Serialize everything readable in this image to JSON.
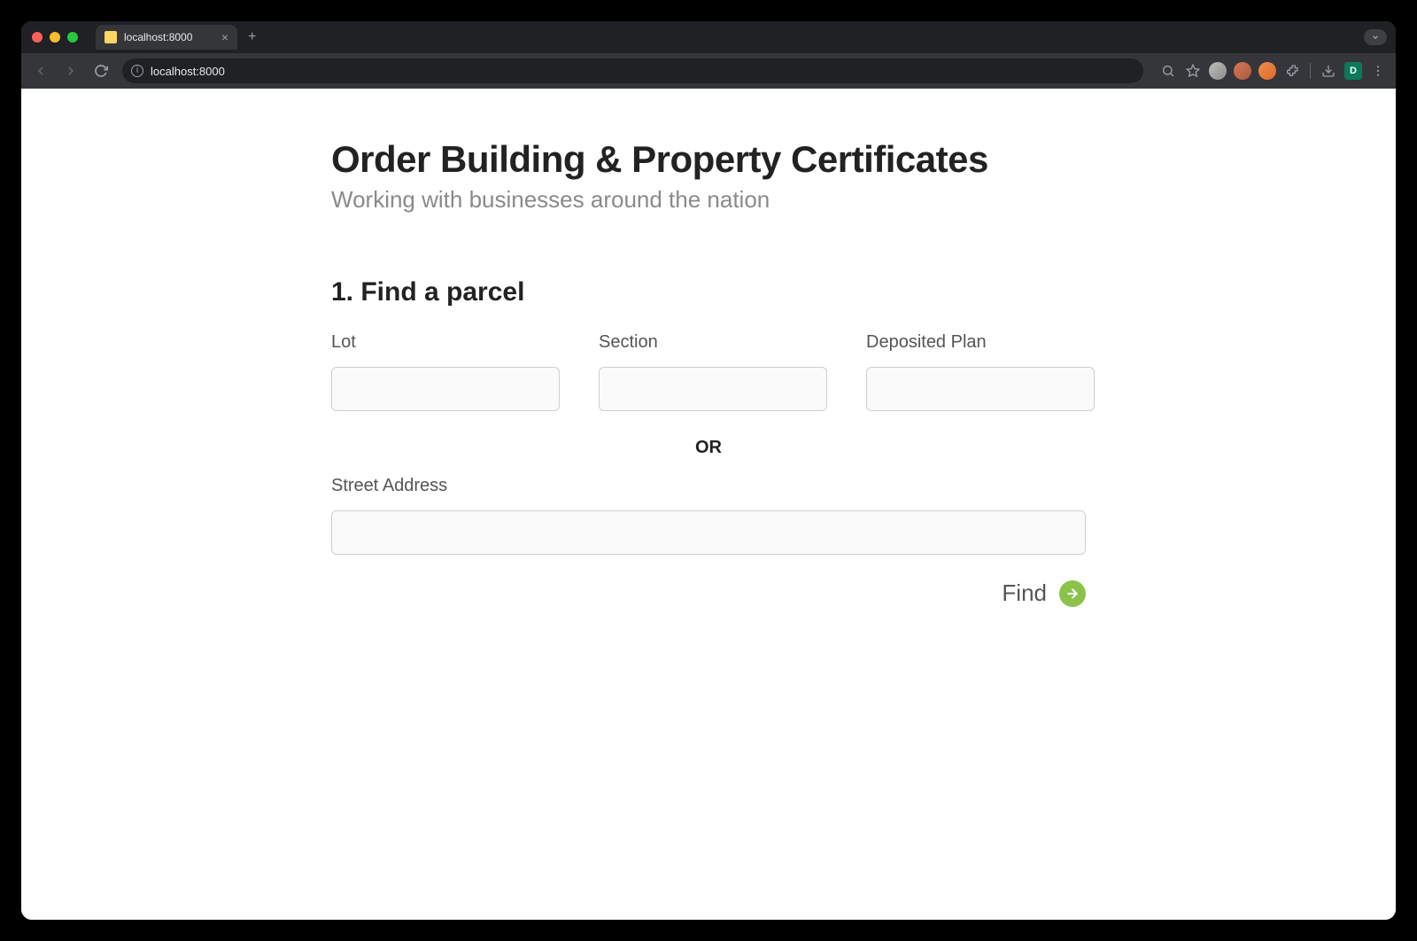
{
  "browser": {
    "tab_title": "localhost:8000",
    "url": "localhost:8000",
    "profile_badge": "D"
  },
  "page": {
    "title": "Order Building & Property Certificates",
    "subtitle": "Working with businesses around the nation",
    "section_heading": "1. Find a parcel",
    "fields": {
      "lot_label": "Lot",
      "lot_value": "",
      "section_label": "Section",
      "section_value": "",
      "plan_label": "Deposited Plan",
      "plan_value": "",
      "or_text": "OR",
      "street_label": "Street Address",
      "street_value": ""
    },
    "find_label": "Find"
  },
  "colors": {
    "accent": "#8bc34a"
  }
}
